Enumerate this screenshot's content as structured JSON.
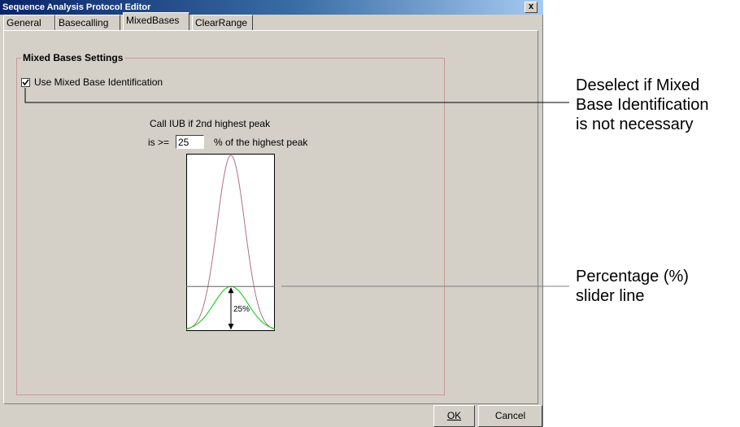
{
  "window": {
    "title": "Sequence Analysis Protocol Editor",
    "close_label": "x"
  },
  "tabs": [
    {
      "label": "General",
      "active": false
    },
    {
      "label": "Basecalling",
      "active": false
    },
    {
      "label": "MixedBases",
      "active": true
    },
    {
      "label": "ClearRange",
      "active": false
    }
  ],
  "group": {
    "title": "Mixed Bases Settings",
    "checkbox_label": "Use Mixed Base Identification",
    "checkbox_checked": true,
    "call_text": "Call IUB if 2nd highest peak",
    "is_prefix": "is >=",
    "percent_value": "25",
    "percent_suffix": "% of the highest peak",
    "slider_label": "25%",
    "slider_level_percent": 25
  },
  "buttons": {
    "ok": "OK",
    "cancel": "Cancel"
  },
  "annotations": {
    "deselect": [
      "Deselect if Mixed",
      "Base Identification",
      "is not necessary"
    ],
    "percentage": [
      "Percentage (%)",
      "slider line"
    ]
  },
  "colors": {
    "titlebar_start": "#0a246a",
    "peak_high": "#b07080",
    "peak_low": "#00cc00",
    "groupbox_border": "#c89898"
  }
}
